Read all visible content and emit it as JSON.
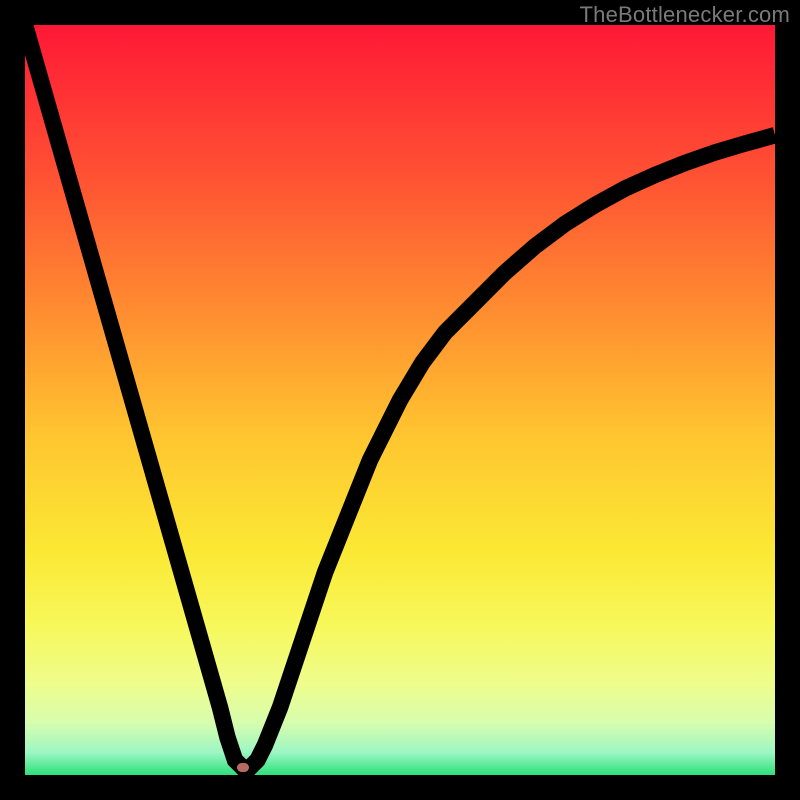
{
  "watermark": "TheBottlenecker.com",
  "chart_data": {
    "type": "line",
    "title": "",
    "xlabel": "",
    "ylabel": "",
    "xlim": [
      0,
      100
    ],
    "ylim": [
      0,
      100
    ],
    "background_gradient": {
      "direction": "vertical",
      "stops": [
        {
          "offset": 0.0,
          "color": "#ff1836"
        },
        {
          "offset": 0.2,
          "color": "#ff5133"
        },
        {
          "offset": 0.4,
          "color": "#ff9330"
        },
        {
          "offset": 0.55,
          "color": "#ffc630"
        },
        {
          "offset": 0.7,
          "color": "#fbe834"
        },
        {
          "offset": 0.8,
          "color": "#f7f85a"
        },
        {
          "offset": 0.88,
          "color": "#eefd8d"
        },
        {
          "offset": 0.93,
          "color": "#d7fdae"
        },
        {
          "offset": 0.97,
          "color": "#9cf6c3"
        },
        {
          "offset": 1.0,
          "color": "#2de07a"
        }
      ]
    },
    "series": [
      {
        "name": "bottleneck-curve",
        "x": [
          0,
          2,
          4,
          6,
          8,
          10,
          12,
          14,
          16,
          18,
          20,
          22,
          24,
          26,
          27,
          28,
          29,
          30,
          31,
          32,
          34,
          36,
          38,
          40,
          42,
          44,
          46,
          48,
          50,
          53,
          56,
          60,
          64,
          68,
          72,
          76,
          80,
          84,
          88,
          92,
          96,
          100
        ],
        "y": [
          100,
          93,
          86,
          79,
          72,
          65,
          58,
          51,
          44,
          37,
          30,
          23,
          16,
          9,
          5,
          2,
          1,
          1,
          2,
          4,
          9,
          15,
          21,
          27,
          32,
          37,
          42,
          46,
          50,
          55,
          59,
          63,
          67,
          70.5,
          73.5,
          76,
          78.2,
          80,
          81.6,
          83,
          84.2,
          85.3
        ]
      }
    ],
    "marker": {
      "name": "optimal-point",
      "x": 29,
      "y": 1,
      "color": "#b96a60",
      "width_pct": 1.6,
      "height_pct": 1.1
    }
  }
}
